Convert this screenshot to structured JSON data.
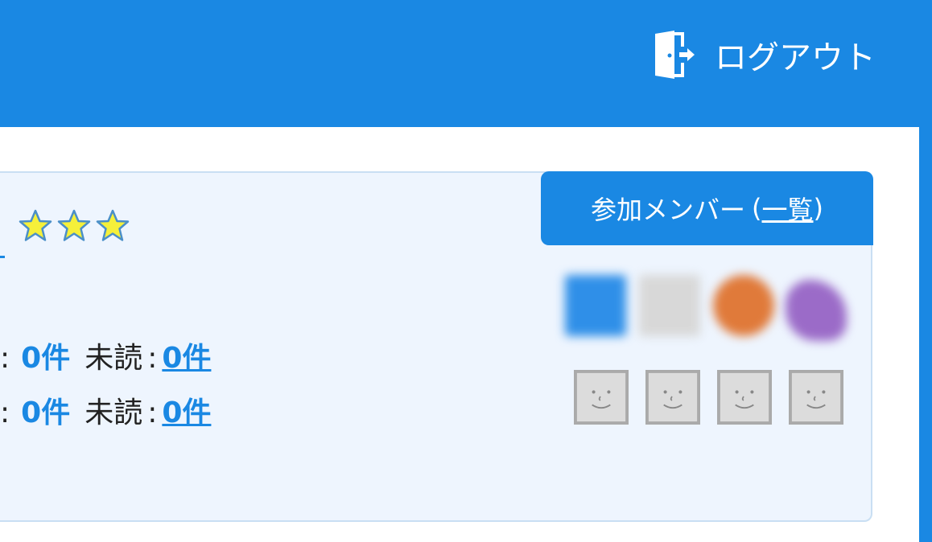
{
  "header": {
    "logout_label": "ログアウト",
    "logout_icon": "door-exit-icon",
    "background_color": "#1a88e3"
  },
  "panel": {
    "rating": {
      "stars": 3,
      "icon": "star-icon",
      "color": "#f5f03a"
    },
    "stats": [
      {
        "colon": ":",
        "count": "0件",
        "unread_label": "未読",
        "unread_colon": ":",
        "unread_count": "0件"
      },
      {
        "colon": ":",
        "count": "0件",
        "unread_label": "未読",
        "unread_colon": ":",
        "unread_count": "0件"
      }
    ],
    "members": {
      "tab_label_prefix": "参加メンバー",
      "tab_label_open": "(",
      "tab_label_link": "一覧",
      "tab_label_close": ")",
      "blurred_avatar_colors": [
        "#2f8fe8",
        "#d8d8d8",
        "#e07a3a",
        "#9b6bc8"
      ],
      "default_avatar_icon": "smiley-face-icon",
      "default_avatar_count": 4
    }
  }
}
